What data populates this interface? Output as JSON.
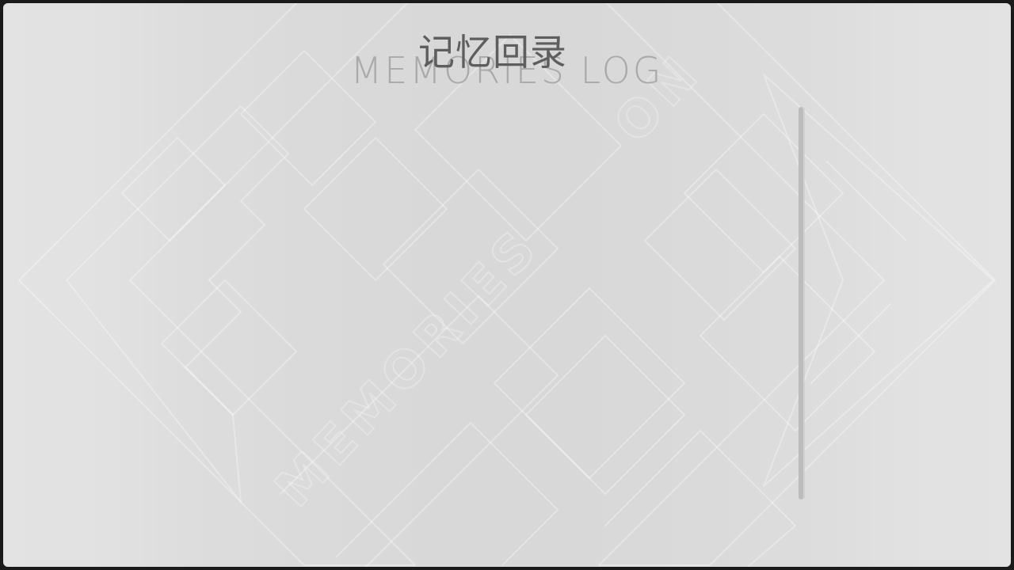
{
  "screen": {
    "title_cn": "记忆回录",
    "title_en": "MEMORIES LOG"
  },
  "watermark": {
    "icon": "memories-logo-watermark",
    "text": "MEMORIES ON"
  },
  "log": {
    "entries": []
  },
  "colors": {
    "background": "#dcdcdc",
    "title": "#5e5e5e",
    "subtitle": "#a9a9a9",
    "scrollbar": "#bcbcbc"
  }
}
